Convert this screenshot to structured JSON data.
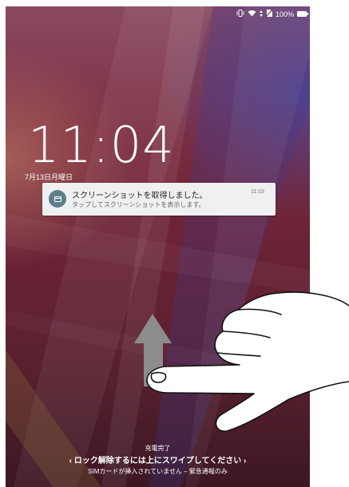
{
  "status_bar": {
    "battery_text": "100%"
  },
  "lockscreen": {
    "time": "11:04",
    "date": "7月13日月曜日"
  },
  "notification": {
    "title": "スクリーンショットを取得しました。",
    "text": "タップしてスクリーンショットを表示します。",
    "time": "11:03",
    "icon": "screenshot-icon"
  },
  "footer": {
    "charging": "充電完了",
    "unlock_hint": "ロック解除するには上にスワイプしてください",
    "sim_notice": "SIMカードが挿入されていません – 緊急通報のみ"
  },
  "overlay": {
    "gesture": "swipe-up",
    "arrow_color": "#8c8c8c"
  }
}
